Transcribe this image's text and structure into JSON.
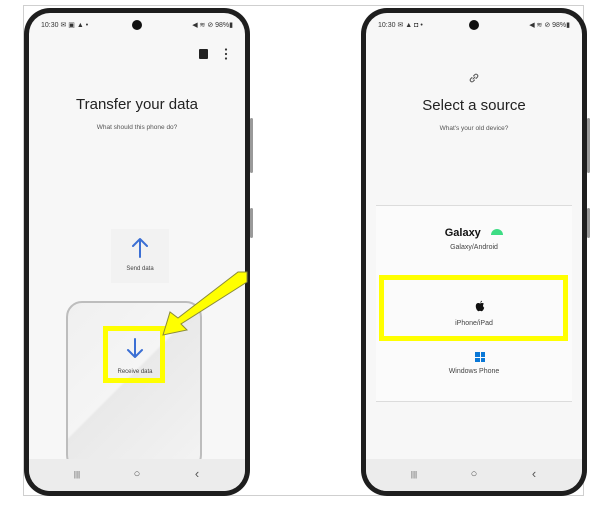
{
  "left_phone": {
    "status_time": "10:30",
    "status_icons_left": "✉ ▣ ▲ •",
    "status_icons_right": "◀ ≋ ⊘ 98%▮",
    "menu_icon": "more-vert-icon",
    "title": "Transfer your data",
    "subtitle": "What should this phone do?",
    "send_label": "Send data",
    "send_icon": "arrow-up-icon",
    "receive_label": "Receive data",
    "receive_icon": "arrow-down-icon",
    "nav": {
      "recents": "|||",
      "home": "○",
      "back": "‹"
    }
  },
  "right_phone": {
    "status_time": "10:30",
    "status_icons_left": "✉ ▲ ◘ •",
    "status_icons_right": "◀ ≋ ⊘ 98%▮",
    "link_icon": "link-icon",
    "title": "Select a source",
    "subtitle": "What's your old device?",
    "galaxy_brand": "Galaxy",
    "galaxy_label": "Galaxy/Android",
    "iphone_label": "iPhone/iPad",
    "windows_label": "Windows Phone",
    "nav": {
      "recents": "|||",
      "home": "○",
      "back": "‹"
    }
  },
  "colors": {
    "highlight": "#ffff00",
    "arrow_blue": "#3b6fd4",
    "android_green": "#3ddc84",
    "windows_blue": "#0a78d7"
  }
}
